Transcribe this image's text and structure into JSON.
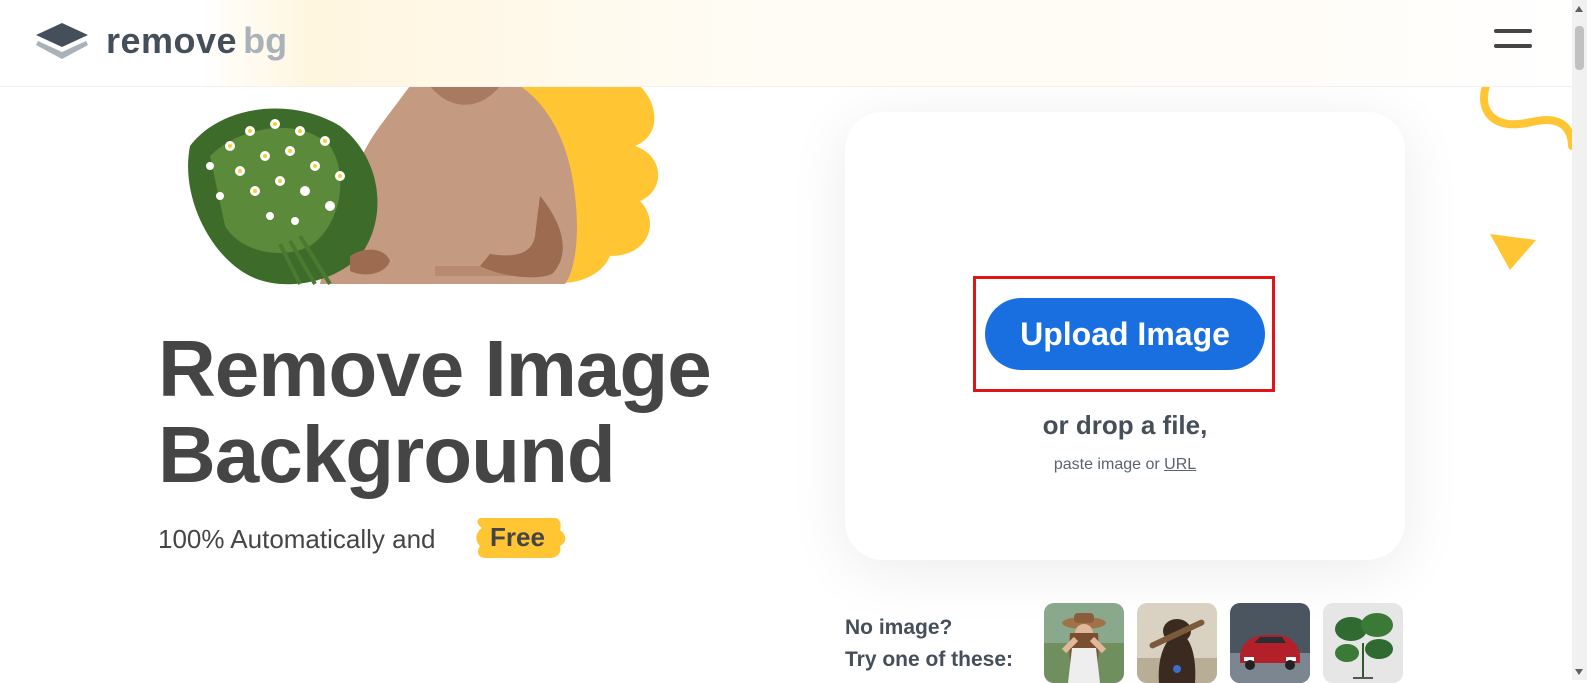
{
  "header": {
    "logo_word": "remove",
    "logo_suffix": "bg",
    "menu_icon": "hamburger-menu-icon"
  },
  "hero": {
    "headline_line1": "Remove Image",
    "headline_line2": "Background",
    "tagline": "100% Automatically and",
    "free_badge": "Free"
  },
  "upload": {
    "button_label": "Upload Image",
    "drop_text": "or drop a file,",
    "paste_prefix": "paste image or",
    "url_link": "URL"
  },
  "samples": {
    "label_line1": "No image?",
    "label_line2": "Try one of these:",
    "thumbnails": [
      "woman-hat-photo",
      "dog-photo",
      "red-car-photo",
      "plant-photo"
    ]
  },
  "colors": {
    "accent_blue": "#1a6fe0",
    "brand_yellow": "#ffc532",
    "text_dark": "#454545",
    "highlight_red": "#e01515"
  }
}
